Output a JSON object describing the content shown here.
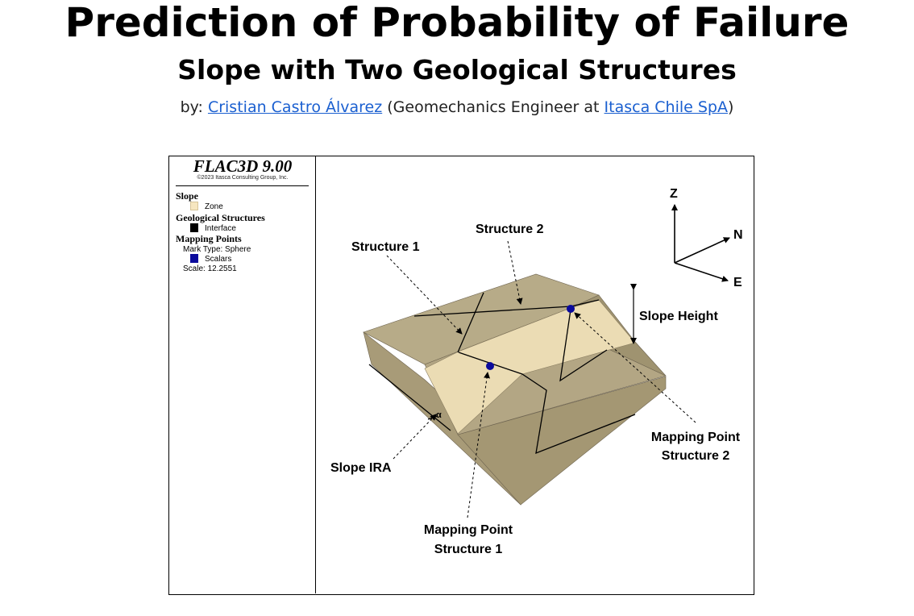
{
  "header": {
    "title": "Prediction of Probability of Failure",
    "subtitle": "Slope with Two Geological Structures",
    "by_prefix": "by: ",
    "author": "Cristian Castro Álvarez",
    "role_text": " (Geomechanics Engineer at ",
    "company": "Itasca Chile SpA",
    "close_paren": ")"
  },
  "legend": {
    "software": "FLAC3D 9.00",
    "copyright": "©2023 Itasca Consulting Group, Inc.",
    "sections": [
      {
        "heading": "Slope",
        "item": "Zone"
      },
      {
        "heading": "Geological Structures",
        "item": "Interface"
      },
      {
        "heading": "Mapping Points",
        "mark_type": "Mark Type: Sphere",
        "item": "Scalars",
        "scale": "Scale: 12.2551"
      }
    ],
    "colors": {
      "zone": "#f6e6c0",
      "interface": "#000000",
      "scalars": "#0a0a9c"
    }
  },
  "diagram": {
    "labels": {
      "structure1": "Structure 1",
      "structure2": "Structure 2",
      "slope_height": "Slope Height",
      "slope_ira": "Slope IRA",
      "alpha": "α",
      "mp1_line1": "Mapping Point",
      "mp1_line2": "Structure 1",
      "mp2_line1": "Mapping Point",
      "mp2_line2": "Structure 2"
    },
    "axes": {
      "z": "Z",
      "n": "N",
      "e": "E"
    },
    "colors": {
      "rock_top": "#b9ad8c",
      "rock_front": "#a89b78",
      "rock_side": "#9c8f6c",
      "slope_face": "#ebdcb4",
      "point": "#0a0a9c"
    }
  }
}
